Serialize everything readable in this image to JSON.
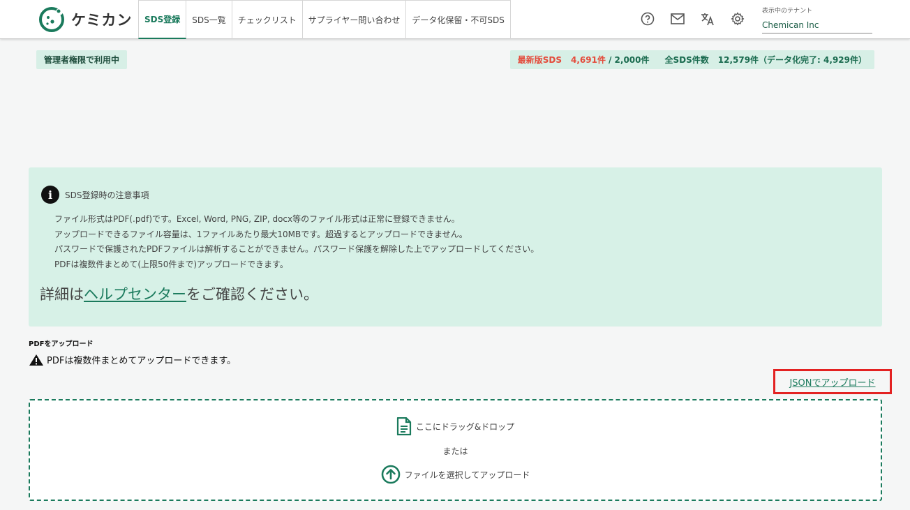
{
  "header": {
    "logo_text": "ケミカン",
    "nav": [
      {
        "label": "SDS登録",
        "active": true
      },
      {
        "label": "SDS一覧",
        "active": false
      },
      {
        "label": "チェックリスト",
        "active": false
      },
      {
        "label": "サプライヤー問い合わせ",
        "active": false
      },
      {
        "label": "データ化保留・不可SDS",
        "active": false
      }
    ],
    "icons": [
      "help-icon",
      "mail-icon",
      "translate-icon",
      "gear-icon"
    ],
    "tenant_label": "表示中のテナント",
    "tenant_value": "Chemican Inc"
  },
  "admin_badge": "管理者権限で利用中",
  "stats": {
    "latest_label": "最新版SDS",
    "latest_count": "4,691件",
    "latest_limit": "/ 2,000件",
    "all_label": "全SDS件数",
    "all_count": "12,579件（データ化完了: 4,929件）"
  },
  "notice": {
    "title": "SDS登録時の注意事項",
    "lines": [
      "ファイル形式はPDF(.pdf)です。Excel, Word, PNG, ZIP, docx等のファイル形式は正常に登録できません。",
      "アップロードできるファイル容量は、1ファイルあたり最大10MBです。超過するとアップロードできません。",
      "パスワードで保護されたPDFファイルは解析することができません。パスワード保護を解除した上でアップロードしてください。",
      "PDFは複数件まとめて(上限50件まで)アップロードできます。"
    ],
    "help_prefix": "詳細は",
    "help_link": "ヘルプセンター",
    "help_suffix": "をご確認ください。"
  },
  "upload": {
    "section_label": "PDFをアップロード",
    "warning": "PDFは複数件まとめてアップロードできます。",
    "json_link": "JSONでアップロード",
    "drop_text": "ここにドラッグ&ドロップ",
    "or_text": "または",
    "select_text": "ファイルを選択してアップロード"
  },
  "colors": {
    "accent": "#1a7a5c",
    "badge_bg": "#d7efe6",
    "notice_bg": "#d7f1e7",
    "red": "#e44b3b",
    "highlight": "#e32222"
  }
}
